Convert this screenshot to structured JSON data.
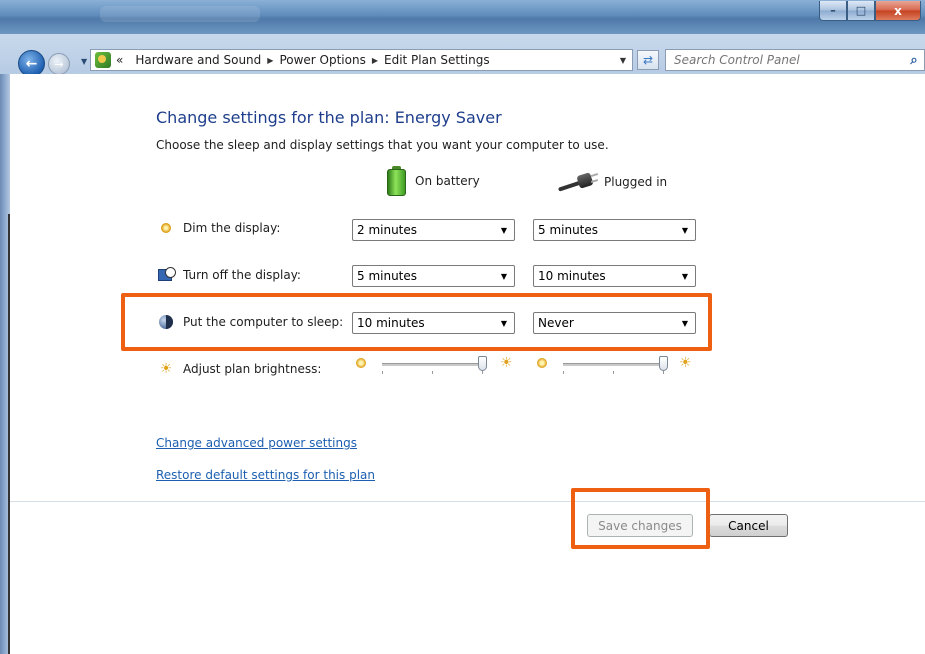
{
  "window": {
    "buttons": {
      "minimize": "–",
      "maximize": "□",
      "close": "x"
    }
  },
  "address": {
    "overflow": "«",
    "breadcrumbs": [
      "Hardware and Sound",
      "Power Options",
      "Edit Plan Settings"
    ],
    "search_placeholder": "Search Control Panel"
  },
  "page": {
    "title": "Change settings for the plan: Energy Saver",
    "subtitle": "Choose the sleep and display settings that you want your computer to use.",
    "columns": {
      "battery": "On battery",
      "plugged": "Plugged in"
    },
    "settings": [
      {
        "label": "Dim the display:",
        "battery": "2 minutes",
        "plugged": "5 minutes"
      },
      {
        "label": "Turn off the display:",
        "battery": "5 minutes",
        "plugged": "10 minutes"
      },
      {
        "label": "Put the computer to sleep:",
        "battery": "10 minutes",
        "plugged": "Never"
      }
    ],
    "brightness": {
      "label": "Adjust plan brightness:",
      "battery_level": 1.0,
      "plugged_level": 1.0
    },
    "links": {
      "advanced": "Change advanced power settings",
      "restore": "Restore default settings for this plan"
    },
    "buttons": {
      "save": "Save changes",
      "cancel": "Cancel"
    }
  },
  "colors": {
    "highlight": "#ee5f12",
    "title": "#1e3e8c",
    "link": "#1c5fb0"
  }
}
